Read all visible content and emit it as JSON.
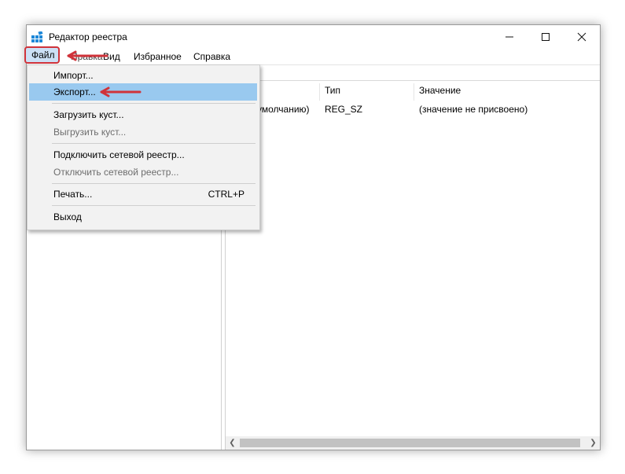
{
  "window": {
    "title": "Редактор реестра",
    "icon": "registry-editor-icon"
  },
  "menubar": {
    "items": [
      "Файл",
      "Правка",
      "Вид",
      "Избранное",
      "Справка"
    ],
    "open_item": "Файл"
  },
  "file_menu": {
    "items": [
      {
        "label": "Импорт...",
        "shortcut": "",
        "disabled": false
      },
      {
        "label": "Экспорт...",
        "shortcut": "",
        "disabled": false,
        "selected": true
      },
      {
        "label": "Загрузить куст...",
        "shortcut": "",
        "disabled": false
      },
      {
        "label": "Выгрузить куст...",
        "shortcut": "",
        "disabled": true
      },
      {
        "label": "Подключить сетевой реестр...",
        "shortcut": "",
        "disabled": false
      },
      {
        "label": "Отключить сетевой реестр...",
        "shortcut": "",
        "disabled": true
      },
      {
        "label": "Печать...",
        "shortcut": "CTRL+P",
        "disabled": false
      },
      {
        "label": "Выход",
        "shortcut": "",
        "disabled": false
      }
    ]
  },
  "list": {
    "columns": [
      "Тип",
      "Значение"
    ],
    "rows": [
      {
        "name_partial": "умолчанию)",
        "type": "REG_SZ",
        "value": "(значение не присвоено)"
      }
    ]
  },
  "colors": {
    "annotation_red": "#d0333a",
    "selection_blue": "#99c9ef",
    "menu_bg": "#f2f2f2"
  }
}
